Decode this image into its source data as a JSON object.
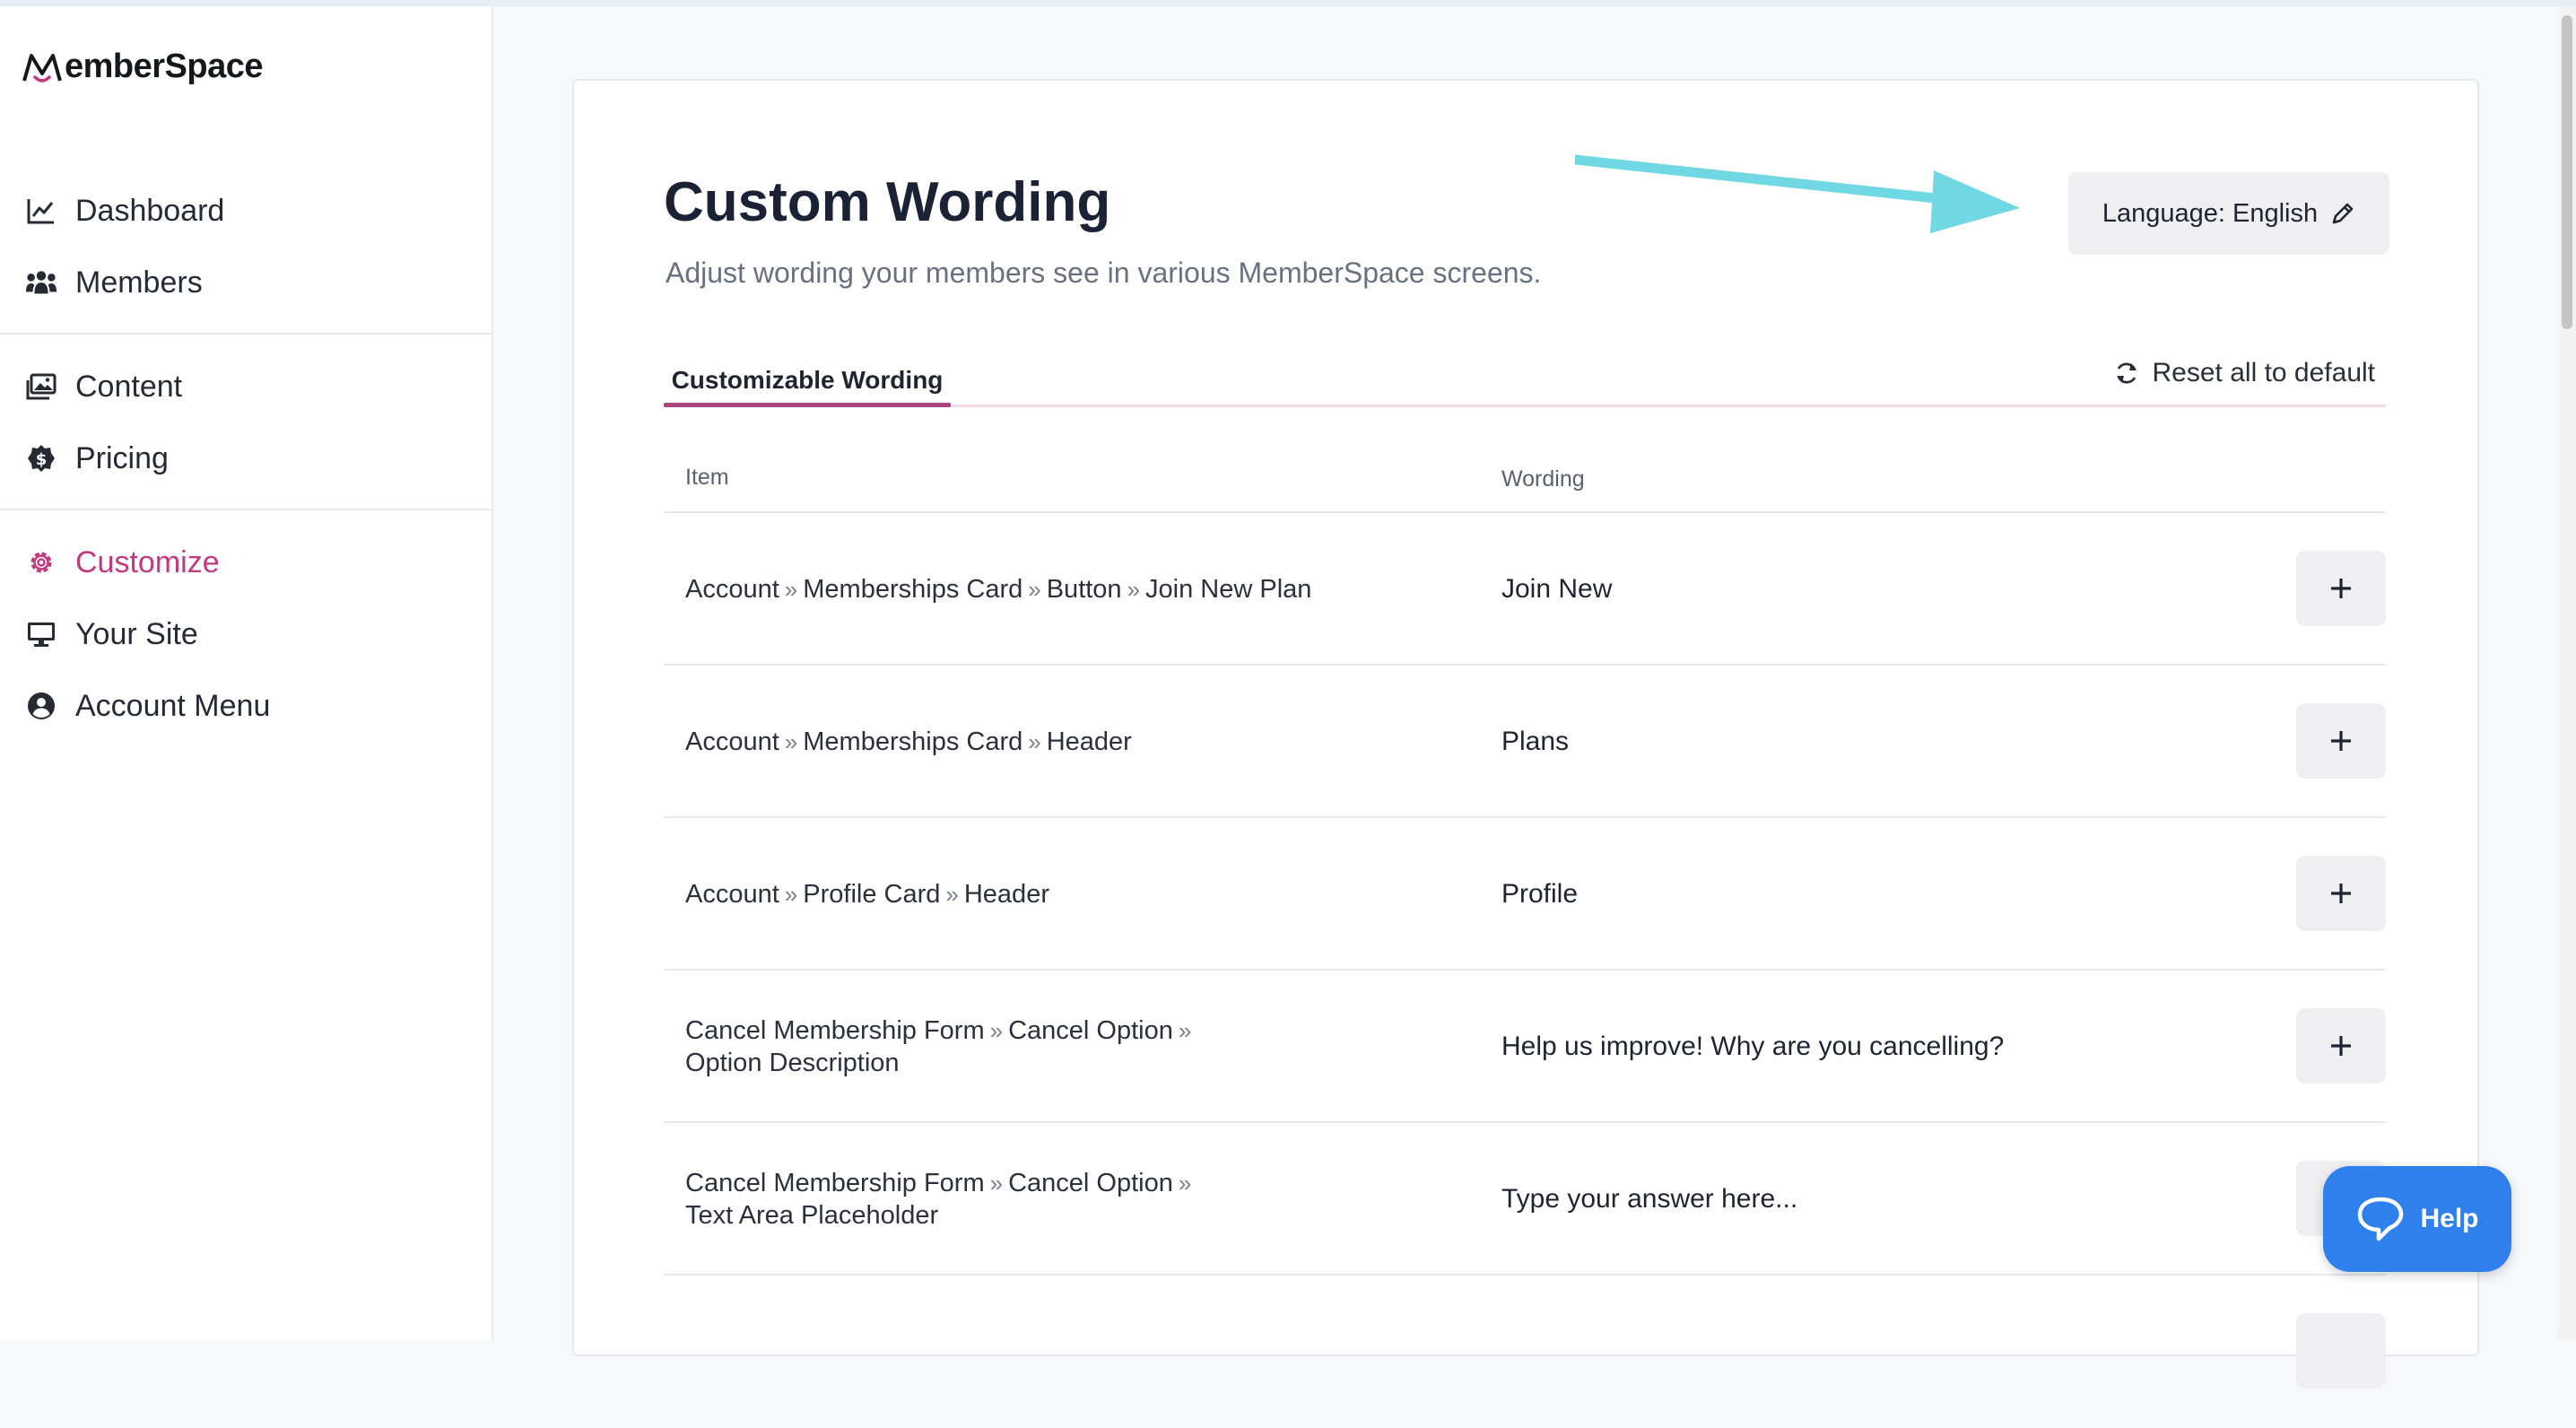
{
  "app": {
    "logo_text": "MemberSpace"
  },
  "sidebar": {
    "groups": [
      [
        {
          "label": "Dashboard",
          "icon": "chart-line-icon"
        },
        {
          "label": "Members",
          "icon": "users-icon"
        }
      ],
      [
        {
          "label": "Content",
          "icon": "images-icon"
        },
        {
          "label": "Pricing",
          "icon": "dollar-badge-icon"
        }
      ],
      [
        {
          "label": "Customize",
          "icon": "gear-icon",
          "active": true
        },
        {
          "label": "Your Site",
          "icon": "monitor-icon"
        },
        {
          "label": "Account Menu",
          "icon": "user-circle-icon"
        }
      ]
    ],
    "active_color": "#c03a7f"
  },
  "page": {
    "title": "Custom Wording",
    "subtitle": "Adjust wording your members see in various MemberSpace screens.",
    "language_button": "Language: English",
    "tab_label": "Customizable Wording",
    "reset_label": "Reset all to default",
    "col_item": "Item",
    "col_wording": "Wording"
  },
  "rows": [
    {
      "crumbs": [
        "Account",
        "Memberships Card",
        "Button",
        "Join New Plan"
      ],
      "wording": "Join New"
    },
    {
      "crumbs": [
        "Account",
        "Memberships Card",
        "Header"
      ],
      "wording": "Plans"
    },
    {
      "crumbs": [
        "Account",
        "Profile Card",
        "Header"
      ],
      "wording": "Profile"
    },
    {
      "crumbs": [
        "Cancel Membership Form",
        "Cancel Option",
        "Option Description"
      ],
      "wording": "Help us improve! Why are you cancelling?"
    },
    {
      "crumbs": [
        "Cancel Membership Form",
        "Cancel Option",
        "Text Area Placeholder"
      ],
      "wording": "Type your answer here..."
    }
  ],
  "help": {
    "label": "Help",
    "color": "#2f80ed"
  },
  "colors": {
    "accent": "#a8437e",
    "annotation_arrow": "#6fd8e2"
  }
}
